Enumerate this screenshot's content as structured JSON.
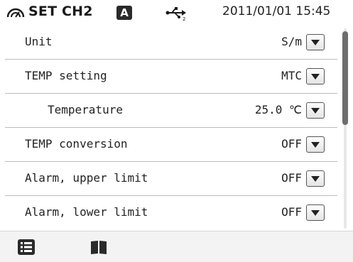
{
  "header": {
    "channel_icon": "channel-gauge-icon",
    "title": "SET CH2",
    "mode_badge": "A",
    "usb_icon": "usb-icon",
    "datetime": "2011/01/01 15:45"
  },
  "settings": [
    {
      "label": "Unit",
      "value": "S/m"
    },
    {
      "label": "TEMP setting",
      "value": "MTC"
    },
    {
      "label": "Temperature",
      "value": "25.0 ℃",
      "indent": true
    },
    {
      "label": "TEMP conversion",
      "value": "OFF"
    },
    {
      "label": "Alarm, upper limit",
      "value": "OFF"
    },
    {
      "label": "Alarm, lower limit",
      "value": "OFF"
    }
  ],
  "scroll": {
    "position_fraction": 0.0,
    "visible_fraction": 0.48
  },
  "footer": {
    "list_icon": "list-icon",
    "book_icon": "book-icon"
  },
  "colors": {
    "dark": "#2a2a2a",
    "divider": "#bdbdbd",
    "footer_bg": "#f3f3f3"
  }
}
